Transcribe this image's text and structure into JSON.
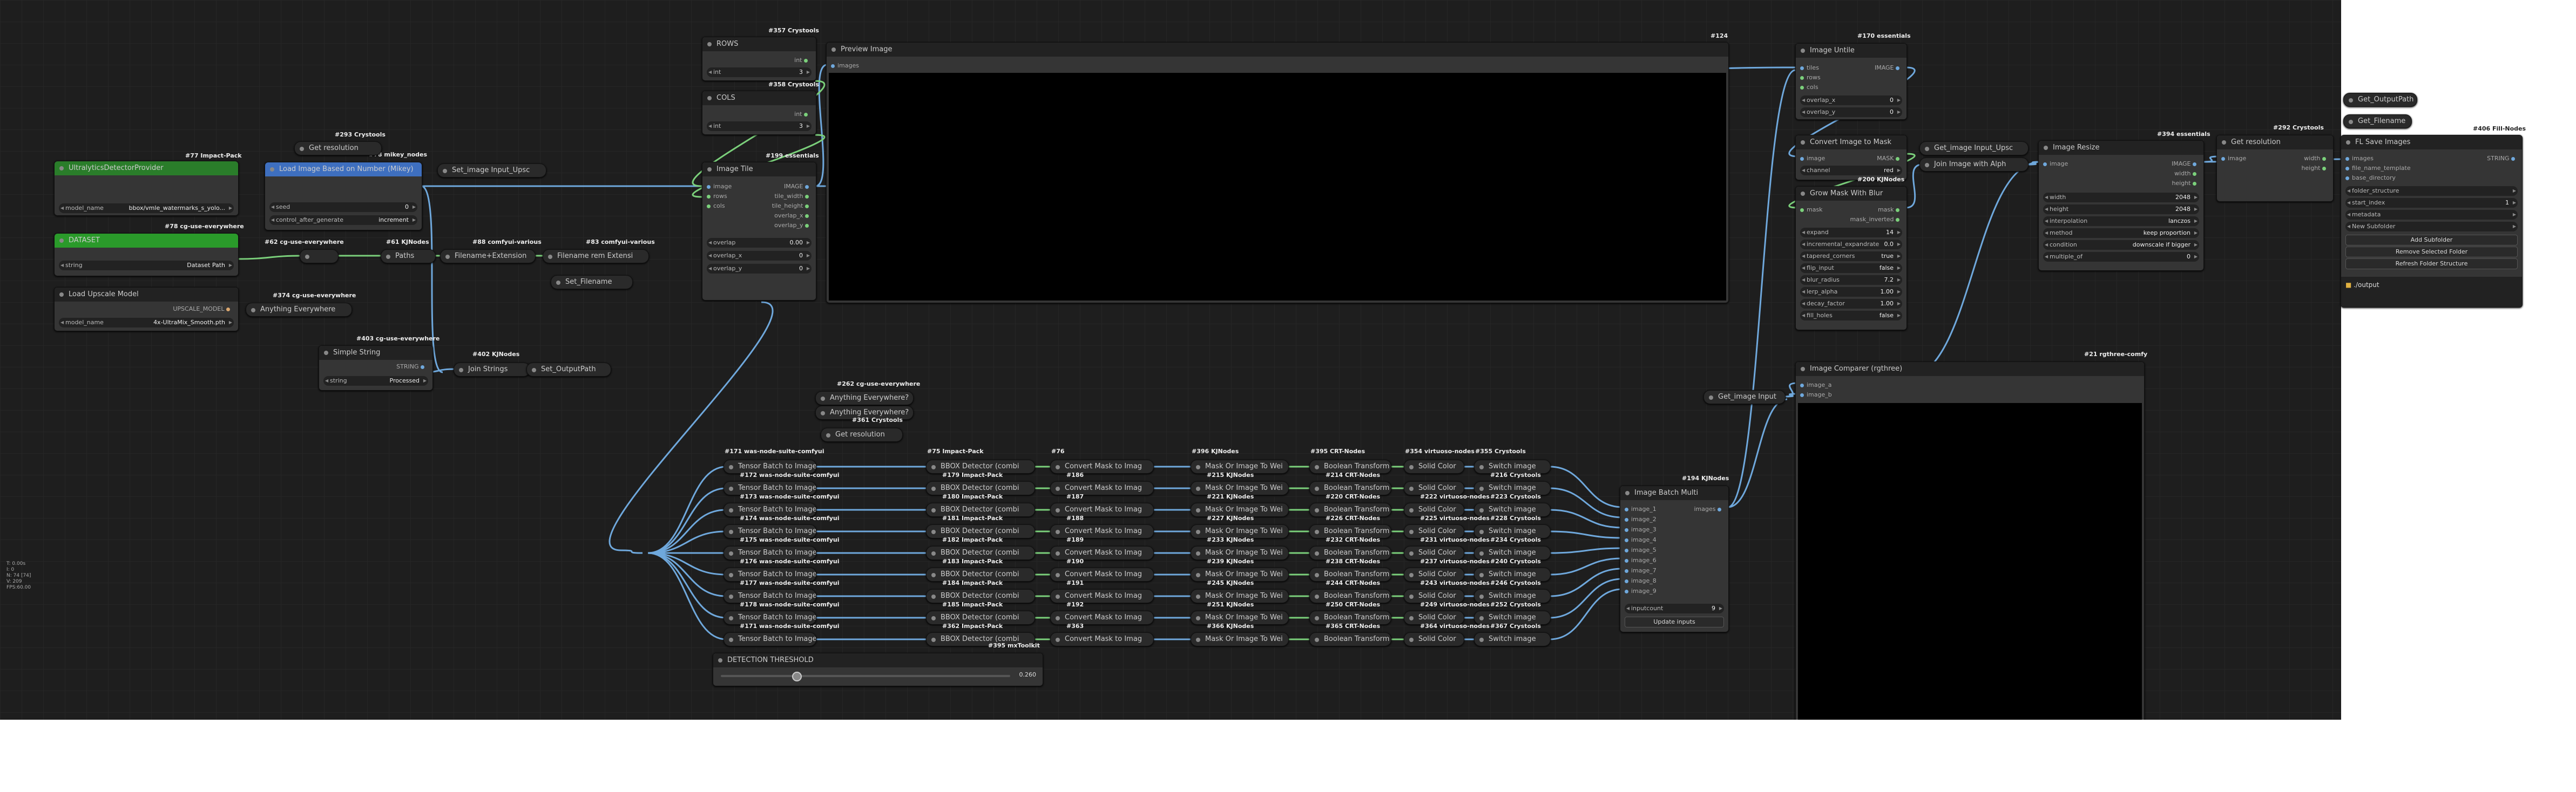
{
  "status_lines": [
    "T: 0.00s",
    "I: 0",
    "N: 74 [74]",
    "V: 209",
    "FPS:60.00"
  ],
  "colors": {
    "canvas_bg": "#1e1e1e",
    "node_bg": "#353535",
    "link_blue": "#6fa8dc",
    "link_green": "#7bd07b",
    "green_node": "#2a7d2a",
    "blue_node": "#3e6fbf"
  },
  "nodes": {
    "watermark": {
      "badge": "#77 Impact-Pack",
      "title": "UltralyticsDetectorProvider",
      "model_label": "model_name",
      "model_value": "bbox/vmle_watermarks_s_yolo..."
    },
    "load_image": {
      "badge": "#78 mikey_nodes",
      "title": "Load Image Based on Number (Mikey)",
      "seed_label": "seed",
      "seed_value": "0",
      "control_label": "control_after_generate",
      "control_value": "increment"
    },
    "get_res_top": {
      "badge": "#293 Crystools",
      "title": "Get resolution"
    },
    "set_image_input": {
      "title": "Set_image Input_Upsc"
    },
    "dataset": {
      "badge": "#78 cg-use-everywhere",
      "title": "DATASET",
      "label": "string",
      "value": "Dataset Path"
    },
    "upscale_model": {
      "title": "Load Upscale Model",
      "out_label": "UPSCALE_MODEL",
      "model_label": "model_name",
      "model_value": "4x-UltraMix_Smooth.pth"
    },
    "anything_everywhere_1": {
      "badge": "#374 cg-use-everywhere",
      "title": "Anything Everywhere"
    },
    "reroute_62": {
      "badge": "#62 cg-use-everywhere"
    },
    "paths": {
      "badge": "#61 KJNodes",
      "title": "Paths"
    },
    "filename_ext": {
      "badge": "#88 comfyui-various",
      "title": "Filename+Extension"
    },
    "filename_rm": {
      "badge": "#83 comfyui-various",
      "title": "Filename rem Extensi"
    },
    "set_filename": {
      "title": "Set_Filename"
    },
    "simple_string": {
      "badge": "#403 cg-use-everywhere",
      "title": "Simple String",
      "out_label": "STRING",
      "label": "string",
      "value": "Processed"
    },
    "join_strings": {
      "badge": "#402 KJNodes",
      "title": "Join Strings"
    },
    "set_outputpath": {
      "title": "Set_OutputPath"
    },
    "rows": {
      "badge": "#357 Crystools",
      "title": "ROWS",
      "out_label": "int",
      "label": "int",
      "value": "3"
    },
    "cols": {
      "badge": "#358 Crystools",
      "title": "COLS",
      "out_label": "int",
      "label": "int",
      "value": "3"
    },
    "image_tile": {
      "badge": "#199 essentials",
      "title": "Image Tile",
      "inputs": [
        "image",
        "rows",
        "cols"
      ],
      "outputs": [
        "IMAGE",
        "tile_width",
        "tile_height",
        "overlap_x",
        "overlap_y"
      ],
      "widgets": [
        {
          "label": "overlap",
          "value": "0.00"
        },
        {
          "label": "overlap_x",
          "value": "0"
        },
        {
          "label": "overlap_y",
          "value": "0"
        }
      ]
    },
    "preview_image": {
      "badge": "#124",
      "title": "Preview Image",
      "input": "images"
    },
    "image_untile": {
      "badge": "#170 essentials",
      "title": "Image Untile",
      "inputs": [
        "tiles",
        "rows",
        "cols"
      ],
      "out_label": "IMAGE",
      "widgets": [
        {
          "label": "overlap_x",
          "value": "0"
        },
        {
          "label": "overlap_y",
          "value": "0"
        }
      ]
    },
    "convert_mask": {
      "badge": "#200 KJNodes",
      "title": "Convert Image to Mask",
      "input": "image",
      "out_label": "MASK",
      "label": "channel",
      "value": "red"
    },
    "grow_mask": {
      "title": "Grow Mask With Blur",
      "input": "mask",
      "outputs": [
        "mask",
        "mask_inverted"
      ],
      "widgets": [
        {
          "label": "expand",
          "value": "14"
        },
        {
          "label": "incremental_expandrate",
          "value": "0.0"
        },
        {
          "label": "tapered_corners",
          "value": "true"
        },
        {
          "label": "flip_input",
          "value": "false"
        },
        {
          "label": "blur_radius",
          "value": "7.2"
        },
        {
          "label": "lerp_alpha",
          "value": "1.00"
        },
        {
          "label": "decay_factor",
          "value": "1.00"
        },
        {
          "label": "fill_holes",
          "value": "false"
        }
      ]
    },
    "get_image_input_upsc": {
      "title": "Get_image Input_Upsc"
    },
    "join_alpha": {
      "title": "Join Image with Alph"
    },
    "image_resize": {
      "badge": "#394 essentials",
      "title": "Image Resize",
      "input": "image",
      "outputs": [
        "IMAGE",
        "width",
        "height"
      ],
      "widgets": [
        {
          "label": "width",
          "value": "2048"
        },
        {
          "label": "height",
          "value": "2048"
        },
        {
          "label": "interpolation",
          "value": "lanczos"
        },
        {
          "label": "method",
          "value": "keep proportion"
        },
        {
          "label": "condition",
          "value": "downscale if bigger"
        },
        {
          "label": "multiple_of",
          "value": "0"
        }
      ]
    },
    "get_res_right": {
      "badge": "#292 Crystools",
      "title": "Get resolution",
      "input": "image",
      "outputs": [
        "width",
        "height"
      ]
    },
    "get_outputpath": {
      "title": "Get_OutputPath"
    },
    "get_filename": {
      "title": "Get_Filename"
    },
    "fl_save": {
      "badge": "#406 Fill-Nodes",
      "title": "FL Save Images",
      "inputs": [
        "images",
        "file_name_template",
        "base_directory"
      ],
      "out_label": "STRING",
      "widgets": [
        {
          "label": "folder_structure",
          "value": ""
        },
        {
          "label": "start_index",
          "value": "1"
        },
        {
          "label": "metadata",
          "value": ""
        },
        {
          "label": "New Subfolder",
          "value": ""
        }
      ],
      "buttons": [
        "Add Subfolder",
        "Remove Selected Folder",
        "Refresh Folder Structure"
      ],
      "folder": "./output"
    },
    "anything_everywhere_2": {
      "badge": "#262 cg-use-everywhere",
      "title": "Anything Everywhere?"
    },
    "anything_everywhere_3": {
      "title": "Anything Everywhere?"
    },
    "get_res_mid": {
      "badge": "#361 Crystools",
      "title": "Get resolution"
    },
    "image_batch_multi": {
      "badge": "#194 KJNodes",
      "title": "Image Batch Multi",
      "inputs": [
        "image_1",
        "image_2",
        "image_3",
        "image_4",
        "image_5",
        "image_6",
        "image_7",
        "image_8",
        "image_9"
      ],
      "out_label": "images",
      "label": "inputcount",
      "value": "9",
      "button": "Update inputs"
    },
    "get_image_input": {
      "title": "Get_image Input"
    },
    "image_comparer": {
      "badge": "#21 rgthree-comfy",
      "title": "Image Comparer (rgthree)",
      "inputs": [
        "image_a",
        "image_b"
      ]
    },
    "detection_threshold": {
      "badge": "#395 mxToolkit",
      "title": "DETECTION THRESHOLD",
      "value": "0.260"
    }
  },
  "pipeline": {
    "header_badges": [
      "#171 was-node-suite-comfyui",
      "#75 Impact-Pack",
      "#76",
      "#396 KJNodes",
      "#395 CRT-Nodes",
      "#354 virtuoso-nodes",
      "#355 Crystools"
    ],
    "col_titles": [
      "Tensor Batch to Image",
      "BBOX Detector (combi",
      "Convert Mask to Imag",
      "Mask Or Image To Wei",
      "Boolean Transform",
      "Solid Color",
      "Switch image"
    ],
    "rows": [
      [
        "#172 was-node-suite-comfyui",
        "#179 Impact-Pack",
        "#186",
        "#215 KJNodes",
        "#214 CRT-Nodes",
        "#216 Crystools"
      ],
      [
        "#173 was-node-suite-comfyui",
        "#180 Impact-Pack",
        "#187",
        "#221 KJNodes",
        "#220 CRT-Nodes",
        "#222 virtuoso-nodes",
        "#223 Crystools"
      ],
      [
        "#174 was-node-suite-comfyui",
        "#181 Impact-Pack",
        "#188",
        "#227 KJNodes",
        "#226 CRT-Nodes",
        "#225 virtuoso-nodes",
        "#228 Crystools"
      ],
      [
        "#175 was-node-suite-comfyui",
        "#182 Impact-Pack",
        "#189",
        "#233 KJNodes",
        "#232 CRT-Nodes",
        "#231 virtuoso-nodes",
        "#234 Crystools"
      ],
      [
        "#176 was-node-suite-comfyui",
        "#183 Impact-Pack",
        "#190",
        "#239 KJNodes",
        "#238 CRT-Nodes",
        "#237 virtuoso-nodes",
        "#240 Crystools"
      ],
      [
        "#177 was-node-suite-comfyui",
        "#184 Impact-Pack",
        "#191",
        "#245 KJNodes",
        "#244 CRT-Nodes",
        "#243 virtuoso-nodes",
        "#246 Crystools"
      ],
      [
        "#178 was-node-suite-comfyui",
        "#185 Impact-Pack",
        "#192",
        "#251 KJNodes",
        "#250 CRT-Nodes",
        "#249 virtuoso-nodes",
        "#252 Crystools"
      ],
      [
        "#171 was-node-suite-comfyui",
        "#362 Impact-Pack",
        "#363",
        "#366 KJNodes",
        "#365 CRT-Nodes",
        "#364 virtuoso-nodes",
        "#367 Crystools"
      ],
      []
    ]
  }
}
